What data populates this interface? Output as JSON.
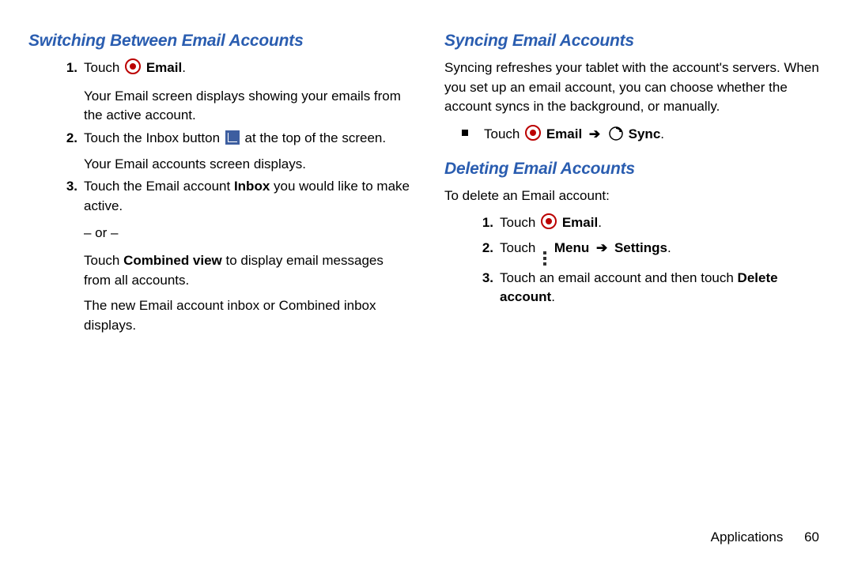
{
  "left": {
    "heading": "Switching Between Email Accounts",
    "step1": {
      "num": "1.",
      "pre": "Touch ",
      "bold": "Email",
      "suffix": ".",
      "sub": "Your Email screen displays showing your emails from the active account."
    },
    "step2": {
      "num": "2.",
      "pre": "Touch the Inbox button ",
      "post": " at the top of the screen.",
      "sub": "Your Email accounts screen displays."
    },
    "step3": {
      "num": "3.",
      "pre": "Touch the Email account ",
      "bold": "Inbox",
      "post": " you would like to make active.",
      "or": "– or –",
      "alt_pre": "Touch ",
      "alt_bold": "Combined view",
      "alt_post": " to display email messages from all accounts.",
      "result": "The new Email account inbox or Combined inbox displays."
    }
  },
  "right": {
    "heading_sync": "Syncing Email Accounts",
    "sync_para": "Syncing refreshes your tablet with the account's servers. When you set up an email account, you can choose whether the account syncs in the background, or manually.",
    "sync_bullet": {
      "pre": "Touch ",
      "email": "Email",
      "arrow": "➔",
      "sync": "Sync",
      "suffix": "."
    },
    "heading_del": "Deleting Email Accounts",
    "del_intro": "To delete an Email account:",
    "del1": {
      "num": "1.",
      "pre": "Touch ",
      "bold": "Email",
      "suffix": "."
    },
    "del2": {
      "num": "2.",
      "pre": "Touch ",
      "menu": "Menu",
      "arrow": "➔",
      "settings": "Settings",
      "suffix": "."
    },
    "del3": {
      "num": "3.",
      "pre": "Touch an email account and then touch ",
      "bold": "Delete account",
      "suffix": "."
    }
  },
  "footer": {
    "section": "Applications",
    "page": "60"
  }
}
